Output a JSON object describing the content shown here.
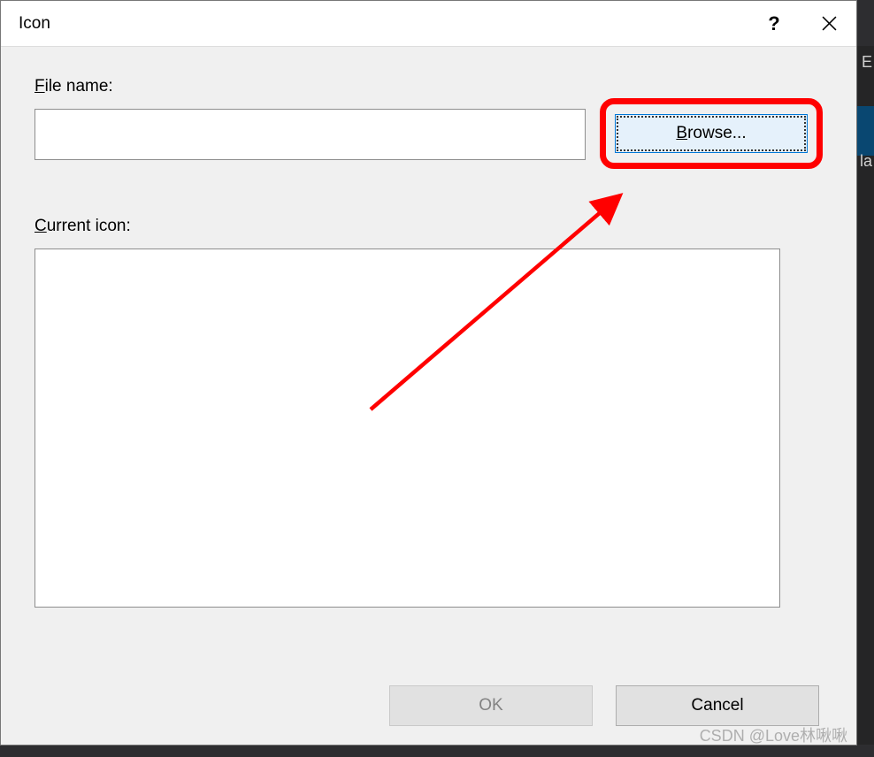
{
  "dialog": {
    "title": "Icon",
    "help_symbol": "?",
    "file_label_prefix": "F",
    "file_label_rest": "ile name:",
    "file_value": "",
    "browse_prefix": "B",
    "browse_rest": "rowse...",
    "current_icon_prefix": "C",
    "current_icon_rest": "urrent icon:",
    "ok_label": "OK",
    "cancel_label": "Cancel"
  },
  "background": {
    "letter_e": "E",
    "letter_la": "la"
  },
  "watermark": "CSDN @Love林啾啾"
}
